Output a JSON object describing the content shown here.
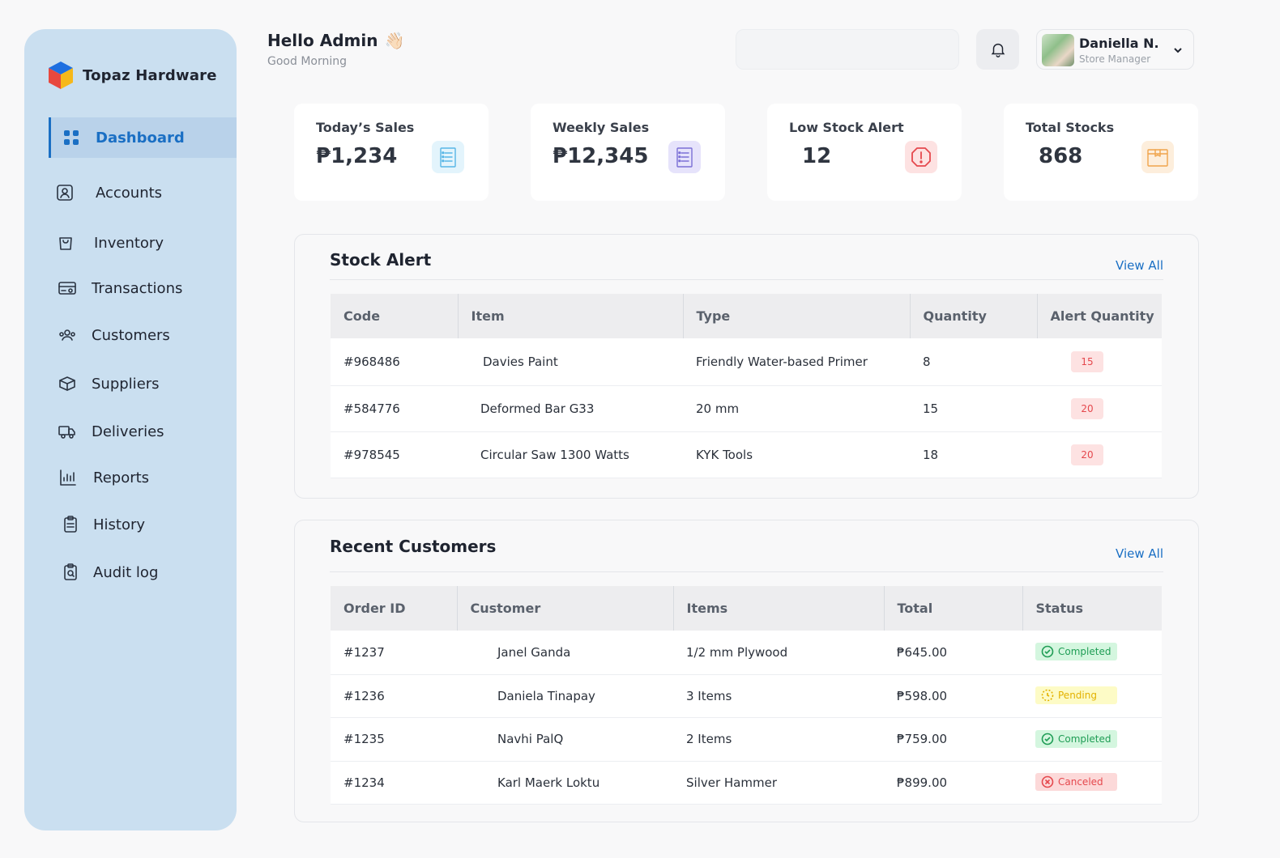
{
  "brand": {
    "name": "Topaz Hardware"
  },
  "sidebar": {
    "items": [
      {
        "label": "Dashboard",
        "icon": "dashboard-icon",
        "active": true
      },
      {
        "label": "Accounts",
        "icon": "user-icon"
      },
      {
        "label": "Inventory",
        "icon": "bag-icon"
      },
      {
        "label": "Transactions",
        "icon": "transactions-icon"
      },
      {
        "label": "Customers",
        "icon": "customers-icon"
      },
      {
        "label": "Suppliers",
        "icon": "box-icon"
      },
      {
        "label": "Deliveries",
        "icon": "truck-icon"
      },
      {
        "label": "Reports",
        "icon": "chart-icon"
      },
      {
        "label": "History",
        "icon": "clipboard-icon"
      },
      {
        "label": "Audit log",
        "icon": "audit-icon"
      }
    ]
  },
  "header": {
    "greeting": "Hello Admin",
    "wave": "👋🏻",
    "subtitle": "Good Morning",
    "user": {
      "name": "Daniella N.",
      "role": "Store Manager"
    }
  },
  "stats": [
    {
      "label": "Today’s Sales",
      "value": "₱1,234",
      "icon": "receipt-icon",
      "color": "#57b6e6"
    },
    {
      "label": "Weekly Sales",
      "value": "₱12,345",
      "icon": "receipt-icon",
      "color": "#7b6fd6"
    },
    {
      "label": "Low Stock Alert",
      "value": "12",
      "icon": "alert-octagon-icon",
      "color": "#e5484d"
    },
    {
      "label": "Total Stocks",
      "value": "868",
      "icon": "package-icon",
      "color": "#f0a44b"
    }
  ],
  "stock_alert": {
    "title": "Stock Alert",
    "view_all": "View All",
    "columns": [
      "Code",
      "Item",
      "Type",
      "Quantity",
      "Alert Quantity"
    ],
    "rows": [
      {
        "code": "#968486",
        "item": "Davies Paint",
        "type": "Friendly Water-based Primer",
        "quantity": "8",
        "alert": "15"
      },
      {
        "code": "#584776",
        "item": "Deformed Bar G33",
        "type": "20 mm",
        "quantity": "15",
        "alert": "20"
      },
      {
        "code": "#978545",
        "item": "Circular Saw 1300 Watts",
        "type": "KYK Tools",
        "quantity": "18",
        "alert": "20"
      }
    ]
  },
  "recent_customers": {
    "title": "Recent Customers",
    "view_all": "View All",
    "columns": [
      "Order ID",
      "Customer",
      "Items",
      "Total",
      "Status"
    ],
    "rows": [
      {
        "order_id": "#1237",
        "customer": "Janel Ganda",
        "items": "1/2 mm Plywood",
        "total": "₱645.00",
        "status": "Completed",
        "status_key": "completed"
      },
      {
        "order_id": "#1236",
        "customer": "Daniela Tinapay",
        "items": "3 Items",
        "total": "₱598.00",
        "status": "Pending",
        "status_key": "pending"
      },
      {
        "order_id": "#1235",
        "customer": "Navhi PalQ",
        "items": "2 Items",
        "total": "₱759.00",
        "status": "Completed",
        "status_key": "completed"
      },
      {
        "order_id": "#1234",
        "customer": "Karl Maerk Loktu",
        "items": "Silver Hammer",
        "total": "₱899.00",
        "status": "Canceled",
        "status_key": "canceled"
      }
    ]
  }
}
